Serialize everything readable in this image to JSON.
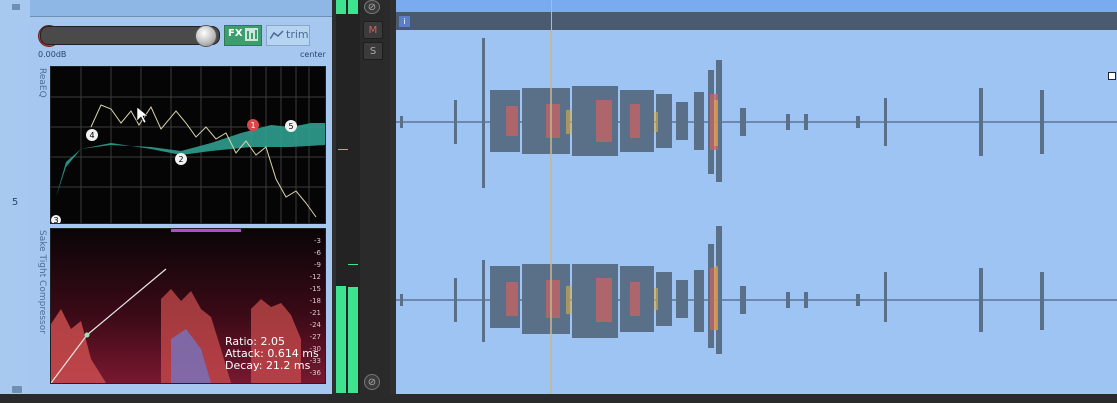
{
  "track": {
    "number": "5",
    "volume": "0.00dB",
    "pan": "center",
    "fx_label": "FX",
    "trim_label": "trim",
    "mute_label": "M",
    "solo_label": "S"
  },
  "plugins": [
    {
      "name": "ReaEQ",
      "bands": [
        "1",
        "2",
        "3",
        "4",
        "5"
      ]
    },
    {
      "name": "Sake Tight Compressor",
      "ratio_text": "Ratio: 2.05",
      "attack_text": "Attack: 0.614 ms",
      "decay_text": "Decay: 21.2 ms",
      "scale": [
        "-3",
        "-6",
        "-9",
        "-12",
        "-15",
        "-18",
        "-21",
        "-24",
        "-27",
        "-30",
        "-33",
        "-36"
      ]
    }
  ],
  "colors": {
    "panel_bg": "#a6c8f0",
    "lane_bg": "#9ec4f3",
    "meter_green": "#3de38f",
    "fx_green": "#3e9d6e",
    "eq_fill": "#2f9f8f"
  },
  "item": {
    "badge": "i"
  },
  "icons": {
    "fx_eq": "eq-icon",
    "trim": "envelope-icon",
    "record": "record-arm-icon"
  }
}
